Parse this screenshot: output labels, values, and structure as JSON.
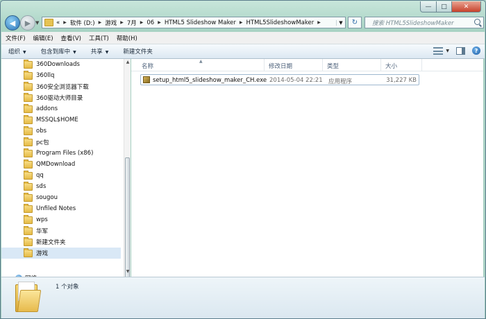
{
  "window": {
    "caption": {
      "minimize": "—",
      "maximize": "□",
      "close": "✕"
    }
  },
  "nav": {
    "back_glyph": "◀",
    "forward_glyph": "▶",
    "overflow": "«",
    "breadcrumb": [
      "软件 (D:)",
      "游戏",
      "7月",
      "06",
      "HTML5 Slideshow Maker",
      "HTML5SlideshowMaker"
    ],
    "search_placeholder": "搜索 HTML5SlideshowMaker"
  },
  "menubar": [
    "文件(F)",
    "编辑(E)",
    "查看(V)",
    "工具(T)",
    "帮助(H)"
  ],
  "commandbar": {
    "organize": "组织",
    "include_in_library": "包含到库中",
    "share": "共享",
    "new_folder": "新建文件夹",
    "help": "?"
  },
  "tree": {
    "items": [
      "360Downloads",
      "360llq",
      "360安全浏览器下载",
      "360驱动大师目录",
      "addons",
      "MSSQL$HOME",
      "obs",
      "pc包",
      "Program Files (x86)",
      "QMDownload",
      "qq",
      "sds",
      "sougou",
      "Unfiled Notes",
      "wps",
      "华军",
      "新建文件夹",
      "游戏"
    ],
    "selected": "游戏",
    "network": "网络"
  },
  "columns": {
    "name": "名称",
    "date": "修改日期",
    "type": "类型",
    "size": "大小"
  },
  "files": [
    {
      "name": "setup_html5_slideshow_maker_CH.exe",
      "date": "2014-05-04 22:21",
      "type": "应用程序",
      "size": "31,227 KB",
      "icon": "exe-icon"
    }
  ],
  "details": {
    "status": "1 个对象"
  },
  "colors": {
    "frame": "#a9d1c3",
    "selection": "#d9e8f6",
    "header_text": "#4c607a"
  }
}
